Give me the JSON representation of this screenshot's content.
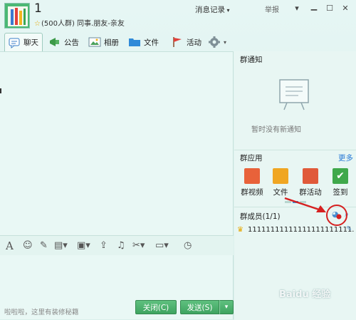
{
  "window": {
    "group_name": "1",
    "group_meta": "(500人群) 同事.朋友-亲友",
    "report_label": "举报",
    "controls": [
      "chevron-down-icon",
      "minimize-icon",
      "maximize-icon",
      "close-icon"
    ]
  },
  "tabs": [
    {
      "label": "聊天",
      "icon": "chat-icon",
      "active": true
    },
    {
      "label": "公告",
      "icon": "announcement-icon"
    },
    {
      "label": "相册",
      "icon": "album-icon"
    },
    {
      "label": "文件",
      "icon": "folder-icon"
    },
    {
      "label": "活动",
      "icon": "flag-icon"
    }
  ],
  "toolbar": {
    "icons": [
      "font-icon",
      "emoji-icon",
      "magic-icon",
      "gift-icon",
      "image-icon",
      "upload-icon",
      "music-icon",
      "screenshot-icon",
      "more-icon"
    ],
    "records_label": "消息记录"
  },
  "composer": {
    "placeholder": "啦啦啦，这里有装修秘籍",
    "close_label": "关闭(C)",
    "send_label": "发送(S)"
  },
  "notice": {
    "title": "群通知",
    "empty_text": "暂时没有新通知"
  },
  "apps": {
    "title": "群应用",
    "more_label": "更多",
    "items": [
      {
        "label": "群视频",
        "color": "#e8623a"
      },
      {
        "label": "文件",
        "color": "#f0a623"
      },
      {
        "label": "群活动",
        "color": "#e05a3a"
      },
      {
        "label": "签到",
        "color": "#3fa84b"
      }
    ]
  },
  "members": {
    "title": "群成员(1/1)",
    "list": [
      {
        "name": "11111111111111111111111..."
      }
    ]
  },
  "watermark": "Baidu 经验"
}
